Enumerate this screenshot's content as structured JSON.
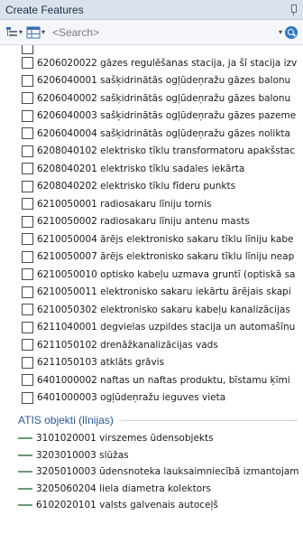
{
  "panel": {
    "title": "Create Features"
  },
  "toolbar": {
    "search_placeholder": "<Search>"
  },
  "polygon_templates": [
    "6206020022 gāzes regulēšanas stacija, ja šī stacija izv",
    "6206040001 sašķidrinātās ogļūdeņražu gāzes balonu",
    "6206040002 sašķidrinātās ogļūdeņražu gāzes balonu",
    "6206040003 sašķidrinātās ogļūdeņražu gāzes pazeme",
    "6206040004 sašķidrinātās ogļūdeņražu gāzes nolikta",
    "6208040102 elektrisko tīklu transformatoru apakšstac",
    "6208040201 elektrisko tīklu sadales iekārta",
    "6208040202 elektrisko tīklu fīderu punkts",
    "6210050001 radiosakaru līniju tornis",
    "6210050002 radiosakaru līniju antenu masts",
    "6210050004 ārējs elektronisko sakaru tīklu līniju kabe",
    "6210050007 ārējs elektronisko sakaru tīklu līniju neap",
    "6210050010 optisko kabeļu uzmava gruntī (optiskā sa",
    "6210050011 elektronisko sakaru iekārtu ārējais skapi",
    "6210050302 elektronisko sakaru kabeļu kanalizācijas",
    "6211040001 degvielas uzpildes stacija un automašīnu",
    "6211050102 drenāžkanalizācijas vads",
    "6211050103 atklāts grāvis",
    "6401000002 naftas un naftas produktu, bīstamu ķīmi",
    "6401000003 ogļūdeņražu ieguves vieta"
  ],
  "line_group": {
    "header": "ATIS objekti (līnijas)",
    "templates": [
      "3101020001 virszemes ūdensobjekts",
      "3203010003 slūžas",
      "3205010003 ūdensnoteka lauksaimniecībā izmantojam",
      "3205060204 liela diametra kolektors",
      "6102020101 valsts galvenais autoceļš"
    ]
  }
}
